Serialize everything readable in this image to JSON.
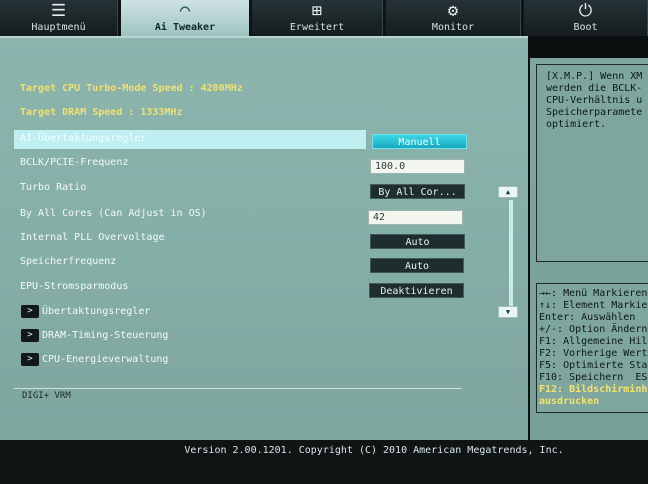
{
  "tabs": [
    {
      "label": "Hauptmenü",
      "icon": "menu-list-icon",
      "glyph": "☰",
      "active": false
    },
    {
      "label": "Ai Tweaker",
      "icon": "tweaker-icon",
      "glyph": "◠",
      "active": true
    },
    {
      "label": "Erweitert",
      "icon": "advanced-icon",
      "glyph": "⊞",
      "active": false
    },
    {
      "label": "Monitor",
      "icon": "monitor-icon",
      "glyph": "⚙",
      "active": false
    },
    {
      "label": "Boot",
      "icon": "power-icon",
      "glyph": "⏻",
      "active": false
    }
  ],
  "info": {
    "cpu_turbo": "Target CPU Turbo-Mode Speed : 4200MHz",
    "dram_speed": "Target DRAM Speed : 1333MHz"
  },
  "settings": [
    {
      "label": "AI-Übertaktungsregler",
      "value": "Manuell"
    },
    {
      "label": "BCLK/PCIE-Frequenz",
      "value": "100.0"
    },
    {
      "label": "Turbo Ratio",
      "value": "By All Cor..."
    },
    {
      "label": "By All Cores (Can Adjust in OS)",
      "value": "42"
    },
    {
      "label": "Internal PLL Overvoltage",
      "value": "Auto"
    },
    {
      "label": "Speicherfrequenz",
      "value": "Auto"
    },
    {
      "label": "EPU-Stromsparmodus",
      "value": "Deaktivieren"
    }
  ],
  "submenus": [
    {
      "label": "Übertaktungsregler",
      "glyph": ">"
    },
    {
      "label": "DRAM-Timing-Steuerung",
      "glyph": ">"
    },
    {
      "label": "CPU-Energieverwaltung",
      "glyph": ">"
    }
  ],
  "digi": "DIGI+ VRM",
  "help_text": "[X.M.P.] Wenn XM\nwerden die BCLK-\nCPU-Verhältnis u\nSpeicherparamete\noptimiert.",
  "keys": [
    "→←: Menü Markieren",
    "↑↓: Element Markie",
    "Enter: Auswählen",
    "+/-: Option Ändern",
    "F1: Allgemeine Hil",
    "F2: Vorherige Wert",
    "F5: Optimierte Sta",
    "F10: Speichern  ES",
    "F12: Bildschirminh",
    "ausdrucken"
  ],
  "scroll": {
    "up": "▲",
    "down": "▼"
  },
  "footer": "Version 2.00.1201. Copyright (C) 2010 American Megatrends, Inc."
}
